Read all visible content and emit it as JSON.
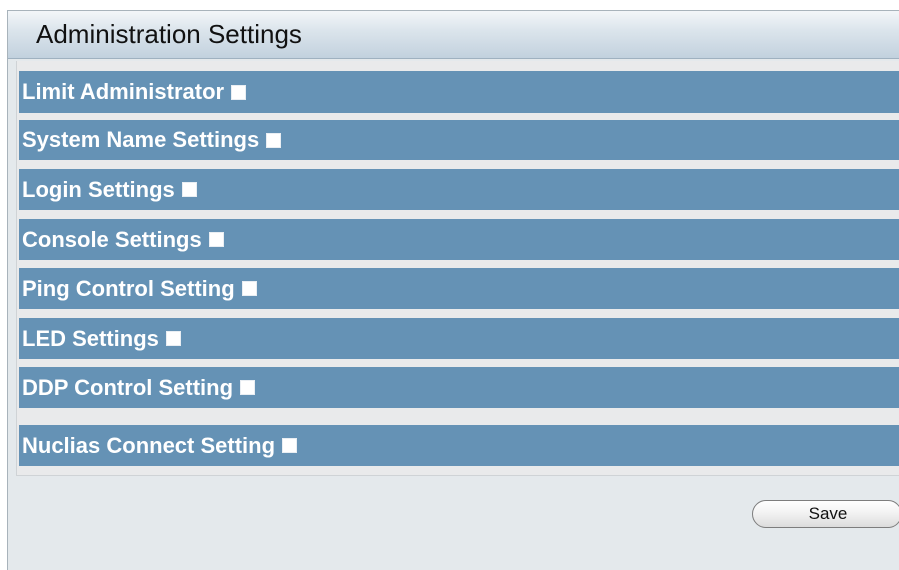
{
  "page": {
    "title": "Administration Settings"
  },
  "settings": [
    {
      "label": "Limit Administrator",
      "checked": false
    },
    {
      "label": "System Name Settings",
      "checked": false
    },
    {
      "label": "Login Settings",
      "checked": false
    },
    {
      "label": "Console Settings",
      "checked": false
    },
    {
      "label": "Ping Control Setting",
      "checked": false
    },
    {
      "label": "LED Settings",
      "checked": false
    },
    {
      "label": "DDP Control Setting",
      "checked": false
    },
    {
      "label": "Nuclias Connect Setting",
      "checked": false
    }
  ],
  "actions": {
    "save_label": "Save"
  },
  "colors": {
    "row_background": "#6592b5",
    "panel_background": "#e4e9ec",
    "label_text": "#ffffff"
  }
}
